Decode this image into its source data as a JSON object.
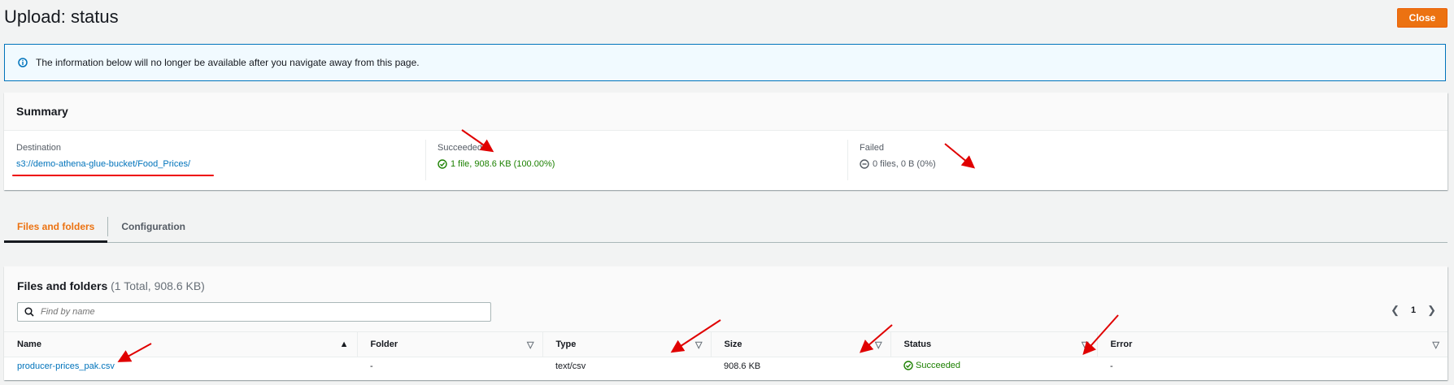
{
  "header": {
    "title": "Upload: status",
    "close_label": "Close"
  },
  "banner": {
    "text": "The information below will no longer be available after you navigate away from this page."
  },
  "summary": {
    "title": "Summary",
    "destination_label": "Destination",
    "destination_value": "s3://demo-athena-glue-bucket/Food_Prices/",
    "succeeded_label": "Succeeded",
    "succeeded_value": "1 file, 908.6 KB (100.00%)",
    "failed_label": "Failed",
    "failed_value": "0 files, 0 B (0%)"
  },
  "tabs": [
    {
      "label": "Files and folders",
      "active": true
    },
    {
      "label": "Configuration",
      "active": false
    }
  ],
  "files": {
    "title": "Files and folders",
    "count_text": "(1 Total, 908.6 KB)",
    "search_placeholder": "Find by name",
    "page": "1",
    "columns": [
      "Name",
      "Folder",
      "Type",
      "Size",
      "Status",
      "Error"
    ],
    "rows": [
      {
        "name": "producer-prices_pak.csv",
        "folder": "-",
        "type": "text/csv",
        "size": "908.6 KB",
        "status": "Succeeded",
        "error": "-"
      }
    ]
  },
  "colors": {
    "accent": "#ec7211",
    "link": "#0073bb",
    "success": "#1d8102",
    "annotation": "#e00000"
  }
}
